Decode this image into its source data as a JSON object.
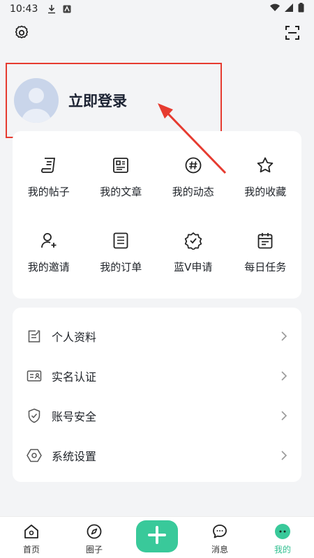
{
  "status_bar": {
    "time": "10:43"
  },
  "header": {
    "login_text": "立即登录"
  },
  "quick_grid": [
    [
      {
        "label": "我的帖子",
        "icon": "post-icon"
      },
      {
        "label": "我的文章",
        "icon": "article-icon"
      },
      {
        "label": "我的动态",
        "icon": "hashtag-icon"
      },
      {
        "label": "我的收藏",
        "icon": "star-icon"
      }
    ],
    [
      {
        "label": "我的邀请",
        "icon": "invite-user-icon"
      },
      {
        "label": "我的订单",
        "icon": "order-icon"
      },
      {
        "label": "蓝V申请",
        "icon": "verified-badge-icon"
      },
      {
        "label": "每日任务",
        "icon": "calendar-icon"
      }
    ]
  ],
  "settings_list": [
    {
      "label": "个人资料",
      "icon": "profile-edit-icon"
    },
    {
      "label": "实名认证",
      "icon": "id-card-icon"
    },
    {
      "label": "账号安全",
      "icon": "shield-icon"
    },
    {
      "label": "系统设置",
      "icon": "hexagon-settings-icon"
    }
  ],
  "tab_bar": [
    {
      "label": "首页",
      "icon": "home-icon"
    },
    {
      "label": "圈子",
      "icon": "compass-icon"
    },
    {
      "label": "消息",
      "icon": "message-icon"
    },
    {
      "label": "我的",
      "icon": "mine-icon",
      "active": true
    }
  ],
  "colors": {
    "accent": "#39c99a",
    "highlight": "#e63b30"
  }
}
